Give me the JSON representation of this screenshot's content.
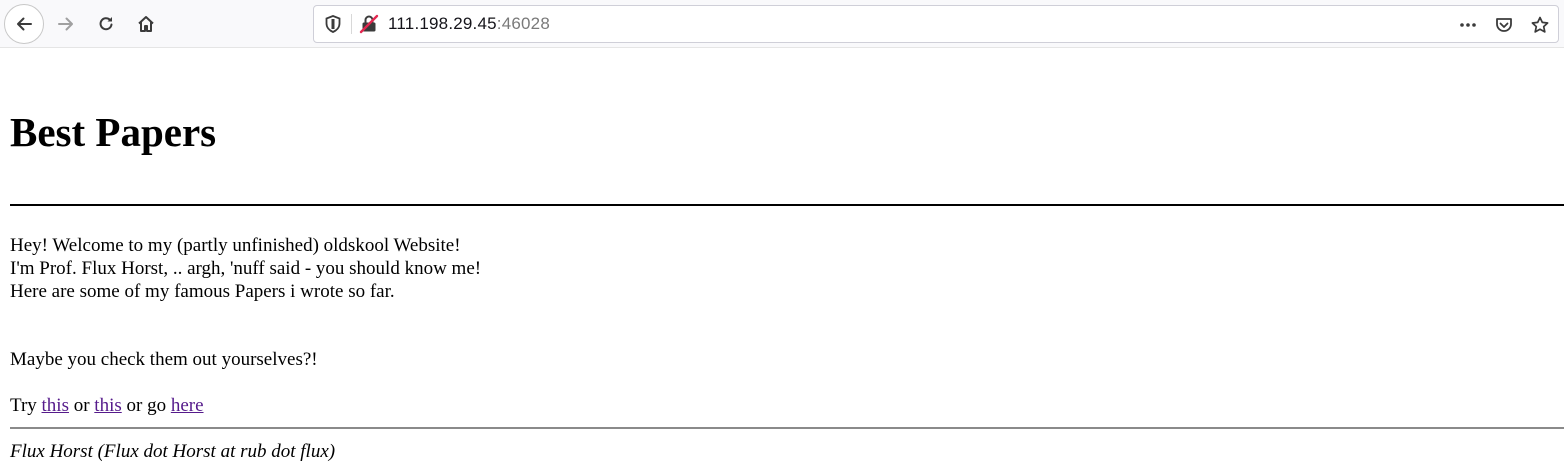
{
  "browser": {
    "url_host": "111.198.29.45",
    "url_port": ":46028"
  },
  "page": {
    "heading": "Best Papers",
    "intro_lines": [
      "Hey! Welcome to my (partly unfinished) oldskool Website!",
      "I'm Prof. Flux Horst, .. argh, 'nuff said - you should know me!",
      "Here are some of my famous Papers i wrote so far."
    ],
    "maybe": "Maybe you check them out yourselves?!",
    "try": {
      "prefix": "Try ",
      "link1": "this",
      "mid1": " or ",
      "link2": "this",
      "mid2": " or go ",
      "link3": "here"
    },
    "footer": "Flux Horst (Flux dot Horst at rub dot flux)",
    "link_color": "#551a8b"
  }
}
